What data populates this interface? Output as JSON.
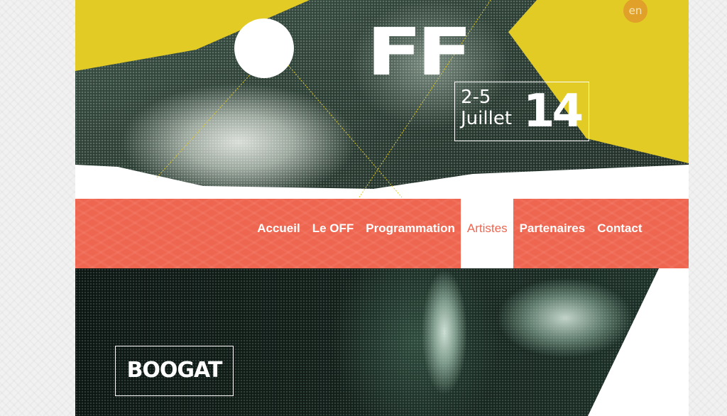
{
  "header": {
    "logo_text": "FF",
    "date_days": "2-5",
    "date_month": "Juillet",
    "date_year": "14",
    "lang_label": "en"
  },
  "nav": {
    "items": [
      {
        "label": "Accueil",
        "active": false
      },
      {
        "label": "Le OFF",
        "active": false
      },
      {
        "label": "Programmation",
        "active": false
      },
      {
        "label": "Artistes",
        "active": true
      },
      {
        "label": "Partenaires",
        "active": false
      },
      {
        "label": "Contact",
        "active": false
      }
    ]
  },
  "artist": {
    "name": "BOOGAT"
  },
  "colors": {
    "yellow": "#e2cb25",
    "coral": "#ef6650",
    "dark_green": "#1f2d26",
    "lang_orange": "#e0a02a"
  }
}
